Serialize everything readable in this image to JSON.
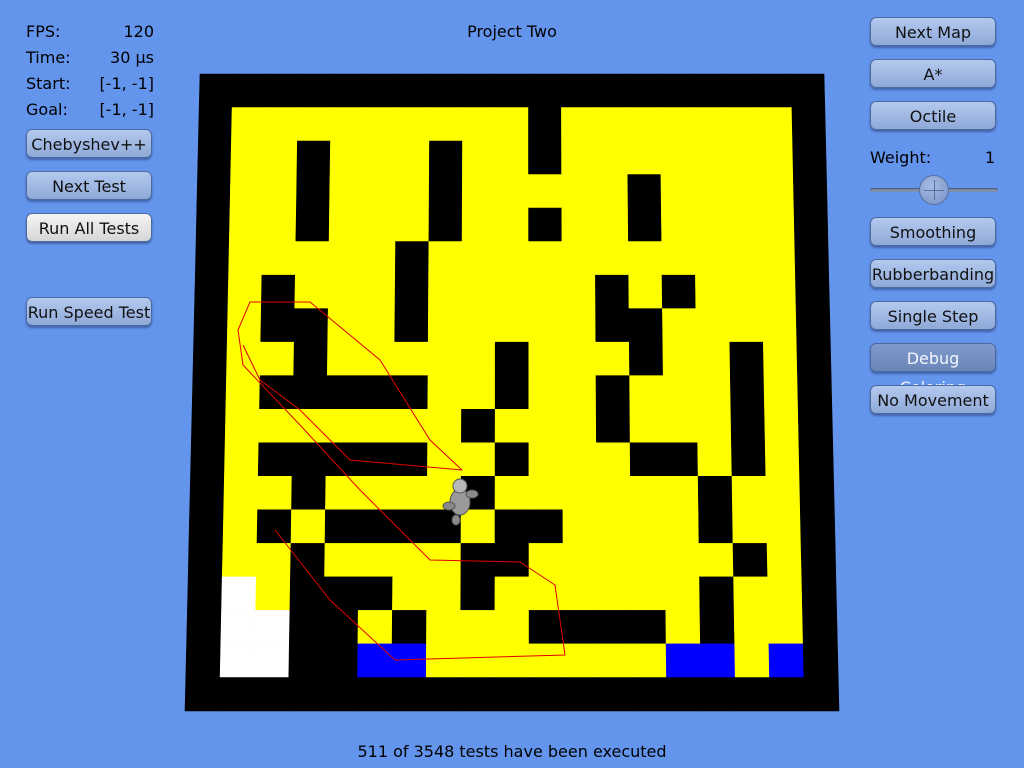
{
  "window": {
    "title": "Project Two"
  },
  "stats": [
    {
      "key": "FPS:",
      "value": "120"
    },
    {
      "key": "Time:",
      "value": "30 µs"
    },
    {
      "key": "Start:",
      "value": "[-1, -1]"
    },
    {
      "key": "Goal:",
      "value": "[-1, -1]"
    }
  ],
  "left_buttons": {
    "heuristic": "Chebyshev++",
    "next_test": "Next Test",
    "run_all_tests": "Run All Tests",
    "run_speed_test": "Run Speed Test"
  },
  "right_buttons": {
    "next_map": "Next Map",
    "algorithm": "A*",
    "distance": "Octile",
    "smoothing": "Smoothing",
    "rubberbanding": "Rubberbanding",
    "single_step": "Single Step",
    "debug_coloring": "Debug Coloring",
    "no_movement": "No Movement"
  },
  "weight": {
    "label": "Weight:",
    "value": "1",
    "slider_fraction": 0.5
  },
  "footer": {
    "status": "511 of 3548 tests have been executed"
  },
  "colors": {
    "background": "#6495ed",
    "wall": "#000000",
    "open": "#ffff00",
    "visited": "#0000ff",
    "unexplored": "#ffffff",
    "path": "#e00000"
  },
  "grid": {
    "size": 19,
    "legend": {
      "#": "wall",
      ".": "open",
      "B": "visited",
      "W": "unexplored"
    },
    "rows": [
      "###################",
      "#.........#.......#",
      "#..#...#..#.......#",
      "#..#...#.....#....#",
      "#..#...#..#..#....#",
      "#.....#...........#",
      "#.#...#.....#.#...#",
      "#.##..#.....##....#",
      "#..#.....#...#..#.#",
      "#.#####..#..#...#.#",
      "#.......#...#...#.#",
      "#.#####..#...##.#.#",
      "#..#....#......#..#",
      "#.#.####.##....#..#",
      "#..#....##......#.#",
      "#W.###..#......#..#",
      "#WW##.#...####.#..#",
      "#WW##BB.......BB.B#",
      "###################"
    ]
  },
  "agent": {
    "name": "agent-character"
  }
}
